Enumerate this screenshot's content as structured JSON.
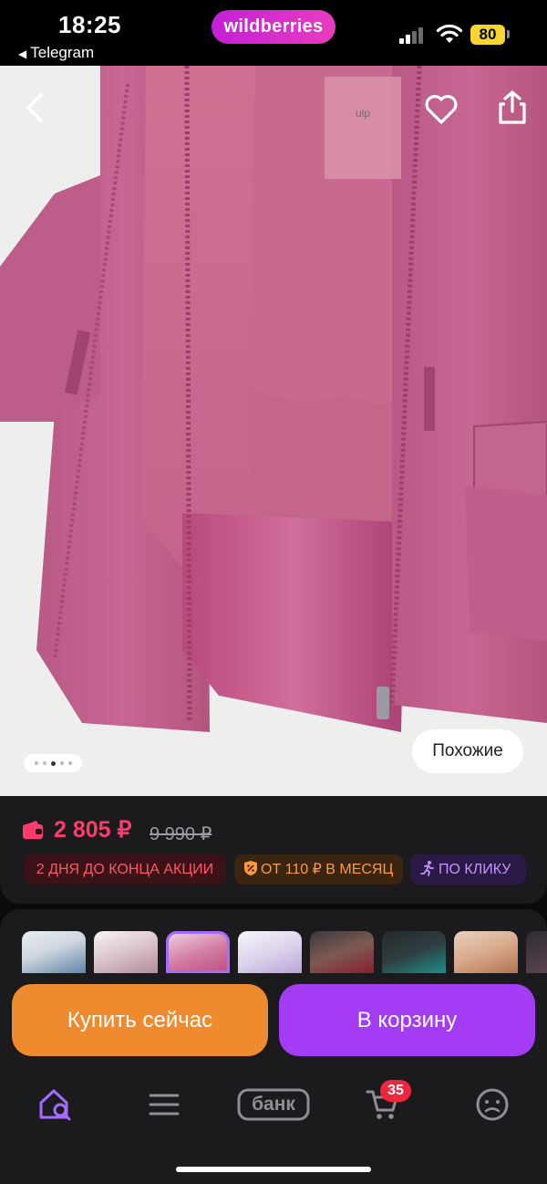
{
  "status_bar": {
    "time": "18:25",
    "back_app": "Telegram",
    "brand": "wildberries",
    "battery": "80"
  },
  "product": {
    "photo_name": "pink-kids-winter-jacket-photo",
    "similar_label": "Похожие",
    "gallery_total": 5,
    "gallery_active": 3
  },
  "price": {
    "current": "2 805 ₽",
    "old": "9 990 ₽"
  },
  "badges": {
    "sale": "2 ДНЯ ДО КОНЦА АКЦИИ",
    "installment": "ОТ 110 ₽ В МЕСЯЦ",
    "click": "ПО КЛИКУ"
  },
  "actions": {
    "buy_now": "Купить сейчас",
    "add_to_cart": "В корзину"
  },
  "tabbar": {
    "bank": "банк",
    "cart_count": "35"
  },
  "colors": {
    "price": "#ff3b6e",
    "buy": "#f08a2e",
    "cart": "#a43bf5",
    "brand": "#cb2bd4"
  }
}
